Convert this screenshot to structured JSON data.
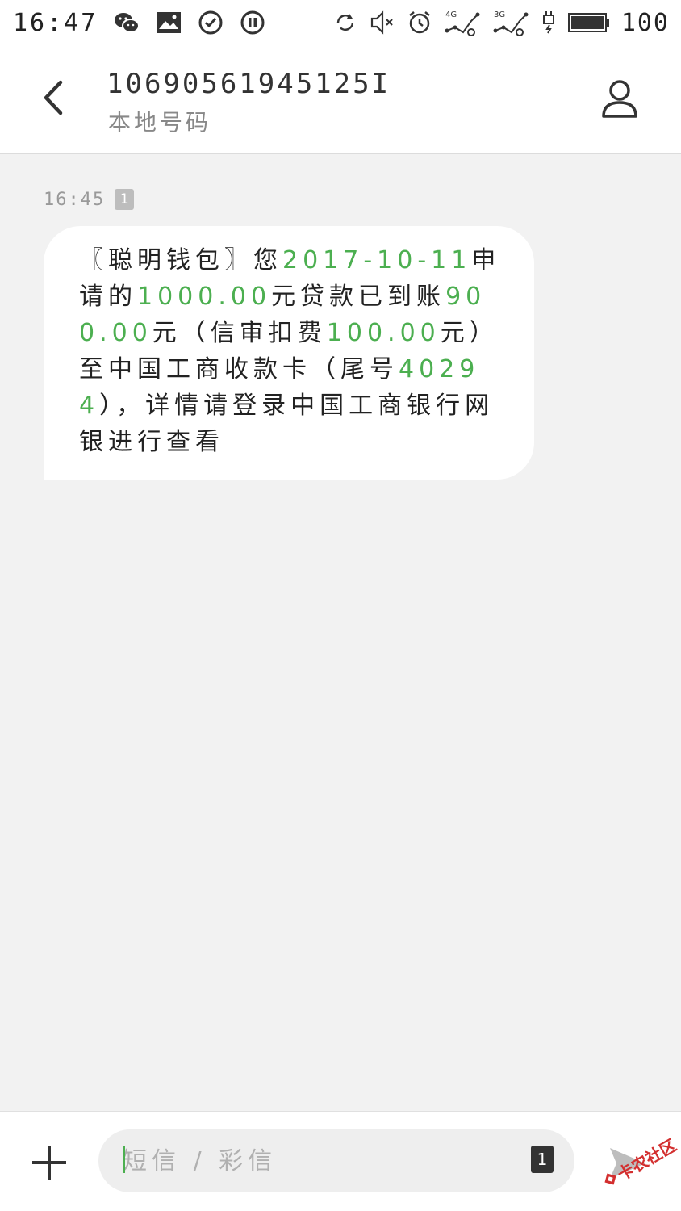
{
  "status_bar": {
    "time": "16:47",
    "battery_level": "100",
    "network_1": "4G",
    "network_2": "3G",
    "icons_left": [
      "wechat-icon",
      "gallery-notification-icon",
      "check-circle-icon",
      "pause-circle-icon"
    ],
    "icons_right": [
      "sync-icon",
      "mute-icon",
      "alarm-icon",
      "signal-4g-icon",
      "signal-3g-icon",
      "charging-icon",
      "battery-icon"
    ]
  },
  "header": {
    "contact_number": "10690561945125I",
    "contact_subtitle": "本地号码"
  },
  "conversation": {
    "messages": [
      {
        "time": "16:45",
        "sim": "1",
        "segments": [
          {
            "text": "〖聪明钱包〗您",
            "highlight": false
          },
          {
            "text": "2017-10-11",
            "highlight": true
          },
          {
            "text": "申请的",
            "highlight": false
          },
          {
            "text": "1000.00",
            "highlight": true
          },
          {
            "text": "元贷款已到账",
            "highlight": false
          },
          {
            "text": "900.00",
            "highlight": true
          },
          {
            "text": "元（信审扣费",
            "highlight": false
          },
          {
            "text": "100.00",
            "highlight": true
          },
          {
            "text": "元）至中国工商收款卡（尾号",
            "highlight": false
          },
          {
            "text": "40294",
            "highlight": true
          },
          {
            "text": "），详情请登录中国工商银行网银进行查看",
            "highlight": false
          }
        ]
      }
    ]
  },
  "composer": {
    "placeholder": "短信 / 彩信",
    "value": "",
    "sim_label": "1"
  },
  "watermark": {
    "text": "卡农社区"
  },
  "colors": {
    "highlight": "#4caf50",
    "background": "#f2f2f2",
    "bubble": "#ffffff"
  }
}
